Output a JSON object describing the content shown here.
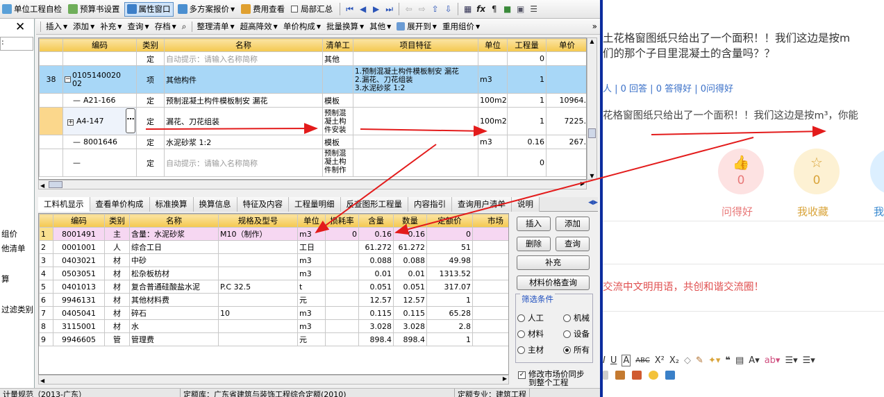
{
  "toolbar1": {
    "items": [
      "单位工程自检",
      "预算书设置",
      "属性窗口",
      "多方案报价",
      "费用查看",
      "局部汇总"
    ]
  },
  "toolbar2": {
    "items": [
      "插入",
      "添加",
      "补充",
      "查询",
      "存档",
      "整理清单",
      "超高降效",
      "单价构成",
      "批量换算",
      "其他",
      "展开到",
      "重用组价"
    ]
  },
  "sidebar": {
    "items": [
      "组价",
      "他清单",
      "算",
      "过滤类别"
    ],
    "field_label": ":"
  },
  "gridA": {
    "headers": [
      "编码",
      "类别",
      "名称",
      "清单工",
      "项目特征",
      "单位",
      "工程量",
      "单价"
    ],
    "rows": [
      {
        "no": "",
        "code": "",
        "type": "定",
        "name": "自动提示：请输入名称简称",
        "dept": "其他",
        "feat": "",
        "unit": "",
        "qty": "0",
        "price": ""
      },
      {
        "no": "38",
        "code": "010514002002",
        "type": "项",
        "name": "其他构件",
        "dept": "",
        "feat": "1.预制混凝土构件模板制安 漏花\n2.漏花、刀花组装\n3.水泥砂浆 1:2",
        "unit": "m3",
        "qty": "1",
        "price": ""
      },
      {
        "no": "",
        "code": "A21-166",
        "type": "定",
        "name": "预制混凝土构件模板制安 漏花",
        "dept": "模板",
        "feat": "",
        "unit": "100m2",
        "qty": "1",
        "price": "10964."
      },
      {
        "no": "",
        "code": "A4-147",
        "type": "定",
        "name": "漏花、刀花组装",
        "dept": "预制混凝土构件安装",
        "feat": "",
        "unit": "100m2",
        "qty": "1",
        "price": "7225."
      },
      {
        "no": "",
        "code": "8001646",
        "type": "定",
        "name": "水泥砂浆 1:2",
        "dept": "模板",
        "feat": "",
        "unit": "m3",
        "qty": "0.16",
        "price": "267."
      },
      {
        "no": "",
        "code": "",
        "type": "定",
        "name": "自动提示：请输入名称简称",
        "dept": "预制混凝土构件制作",
        "feat": "",
        "unit": "",
        "qty": "0",
        "price": ""
      }
    ]
  },
  "tabs": [
    "工料机显示",
    "查看单价构成",
    "标准换算",
    "换算信息",
    "特征及内容",
    "工程量明细",
    "反查图形工程量",
    "内容指引",
    "查询用户清单",
    "说明"
  ],
  "gridB": {
    "headers": [
      "编码",
      "类别",
      "名称",
      "规格及型号",
      "单位",
      "损耗率",
      "含量",
      "数量",
      "定额价",
      "市场"
    ],
    "rows": [
      [
        "1",
        "8001491",
        "主",
        "含量：水泥砂浆",
        "M10（制作）",
        "m3",
        "0",
        "0.16",
        "0.16",
        "0",
        ""
      ],
      [
        "2",
        "0001001",
        "人",
        "综合工日",
        "",
        "工日",
        "",
        "61.272",
        "61.272",
        "51",
        ""
      ],
      [
        "3",
        "0403021",
        "材",
        "中砂",
        "",
        "m3",
        "",
        "0.088",
        "0.088",
        "49.98",
        ""
      ],
      [
        "4",
        "0503051",
        "材",
        "松杂板枋材",
        "",
        "m3",
        "",
        "0.01",
        "0.01",
        "1313.52",
        "1"
      ],
      [
        "5",
        "0401013",
        "材",
        "复合普通硅酸盐水泥",
        "P.C 32.5",
        "t",
        "",
        "0.051",
        "0.051",
        "317.07",
        ""
      ],
      [
        "6",
        "9946131",
        "材",
        "其他材料费",
        "",
        "元",
        "",
        "12.57",
        "12.57",
        "1",
        ""
      ],
      [
        "7",
        "0405041",
        "材",
        "碎石",
        "10",
        "m3",
        "",
        "0.115",
        "0.115",
        "65.28",
        ""
      ],
      [
        "8",
        "3115001",
        "材",
        "水",
        "",
        "m3",
        "",
        "3.028",
        "3.028",
        "2.8",
        ""
      ],
      [
        "9",
        "9946605",
        "管",
        "管理费",
        "",
        "元",
        "",
        "898.4",
        "898.4",
        "1",
        ""
      ]
    ]
  },
  "buttons": {
    "insert": "插入",
    "add": "添加",
    "delete": "删除",
    "query": "查询",
    "supplement": "补充",
    "price_query": "材料价格查询"
  },
  "filter": {
    "title": "筛选条件",
    "options": [
      "人工",
      "机械",
      "材料",
      "设备",
      "主材",
      "所有"
    ],
    "selected": "所有"
  },
  "sync_checkbox": {
    "label": "修改市场价同步到整个工程",
    "checked": true
  },
  "status": {
    "left": "计量规范（2013-广东）",
    "middle": "定额库：广东省建筑与装饰工程综合定额(2010)",
    "right": "定额专业：建筑工程"
  },
  "qa": {
    "question": "土花格窗图纸只给出了一个面积！！我们这边是按m\n们的那个子目里混凝土的含量吗？？",
    "meta": "人 | 0 回答 | 0 答得好 | 0问得好",
    "answer": "花格窗图纸只给出了一个面积！！我们这边是按m³，你能",
    "counts": {
      "ask_good": "0",
      "favorite": "0"
    },
    "labels": {
      "ask_good": "问得好",
      "favorite": "我收藏",
      "me": "我"
    },
    "note": "交流中文明用语，共创和谐交流圈！",
    "colors": {
      "ask_good": "#e87878",
      "favorite": "#d9a43a",
      "link": "#3a70c8"
    }
  }
}
